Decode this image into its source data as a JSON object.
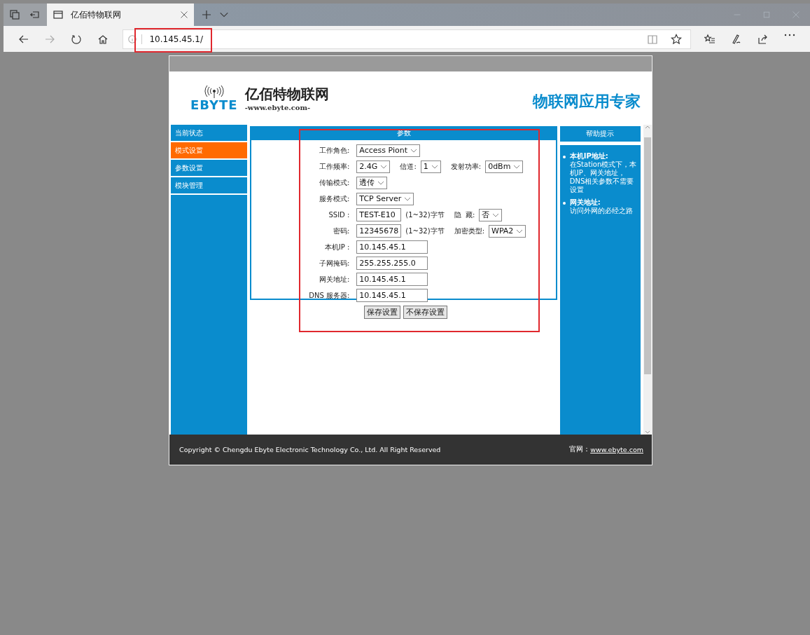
{
  "browser": {
    "tabs": [
      {
        "title": "亿佰特物联网",
        "selected": true
      }
    ],
    "address": "10.145.45.1/"
  },
  "page": {
    "brand": {
      "name": "亿佰特物联网",
      "url": "-www.ebyte.com-",
      "logo_text": "EBYTE"
    },
    "slogan": "物联网应用专家",
    "sidebar": [
      {
        "label": "当前状态",
        "selected": false
      },
      {
        "label": "模式设置",
        "selected": true
      },
      {
        "label": "参数设置",
        "selected": false
      },
      {
        "label": "模块管理",
        "selected": false
      }
    ],
    "panel": {
      "title": "参数",
      "rows": [
        {
          "label": "工作角色:",
          "items": [
            {
              "kind": "select",
              "value": "Access Piont"
            }
          ]
        },
        {
          "label": "工作频率:",
          "items": [
            {
              "kind": "select",
              "value": "2.4G"
            },
            {
              "kind": "label",
              "text": "信道:"
            },
            {
              "kind": "select",
              "value": "1"
            },
            {
              "kind": "label",
              "text": "发射功率:"
            },
            {
              "kind": "select",
              "value": "0dBm"
            }
          ]
        },
        {
          "label": "传输模式:",
          "items": [
            {
              "kind": "select",
              "value": "透传"
            }
          ]
        },
        {
          "label": "服务模式:",
          "items": [
            {
              "kind": "select",
              "value": "TCP Server"
            }
          ]
        },
        {
          "label": "SSID :",
          "items": [
            {
              "kind": "input",
              "value": "TEST-E10"
            },
            {
              "kind": "note",
              "text": "(1~32)字节"
            },
            {
              "kind": "label",
              "text": "隐  藏:"
            },
            {
              "kind": "select",
              "value": "否"
            }
          ]
        },
        {
          "label": "密码:",
          "items": [
            {
              "kind": "input",
              "value": "12345678"
            },
            {
              "kind": "note",
              "text": "(1~32)字节"
            },
            {
              "kind": "label",
              "text": "加密类型:"
            },
            {
              "kind": "select",
              "value": "WPA2"
            }
          ]
        },
        {
          "label": "本机IP :",
          "items": [
            {
              "kind": "wide_input",
              "value": "10.145.45.1"
            }
          ]
        },
        {
          "label": "子网掩码:",
          "items": [
            {
              "kind": "wide_input",
              "value": "255.255.255.0"
            }
          ]
        },
        {
          "label": "网关地址:",
          "items": [
            {
              "kind": "wide_input",
              "value": "10.145.45.1"
            }
          ]
        },
        {
          "label": "DNS 服务器:",
          "items": [
            {
              "kind": "wide_input",
              "value": "10.145.45.1"
            }
          ]
        }
      ],
      "buttons": [
        "保存设置",
        "不保存设置"
      ]
    },
    "help": {
      "title": "帮助提示",
      "items": [
        {
          "title": "本机IP地址:",
          "text": "在Station模式下，本机IP、网关地址，DNS相关参数不需要设置"
        },
        {
          "title": "网关地址:",
          "text": "访问外网的必经之路"
        }
      ]
    },
    "footer": {
      "copyright": "Copyright © Chengdu Ebyte Electronic Technology Co., Ltd. All Right Reserved",
      "site_label": "官网：",
      "site_link": "www.ebyte.com"
    }
  }
}
